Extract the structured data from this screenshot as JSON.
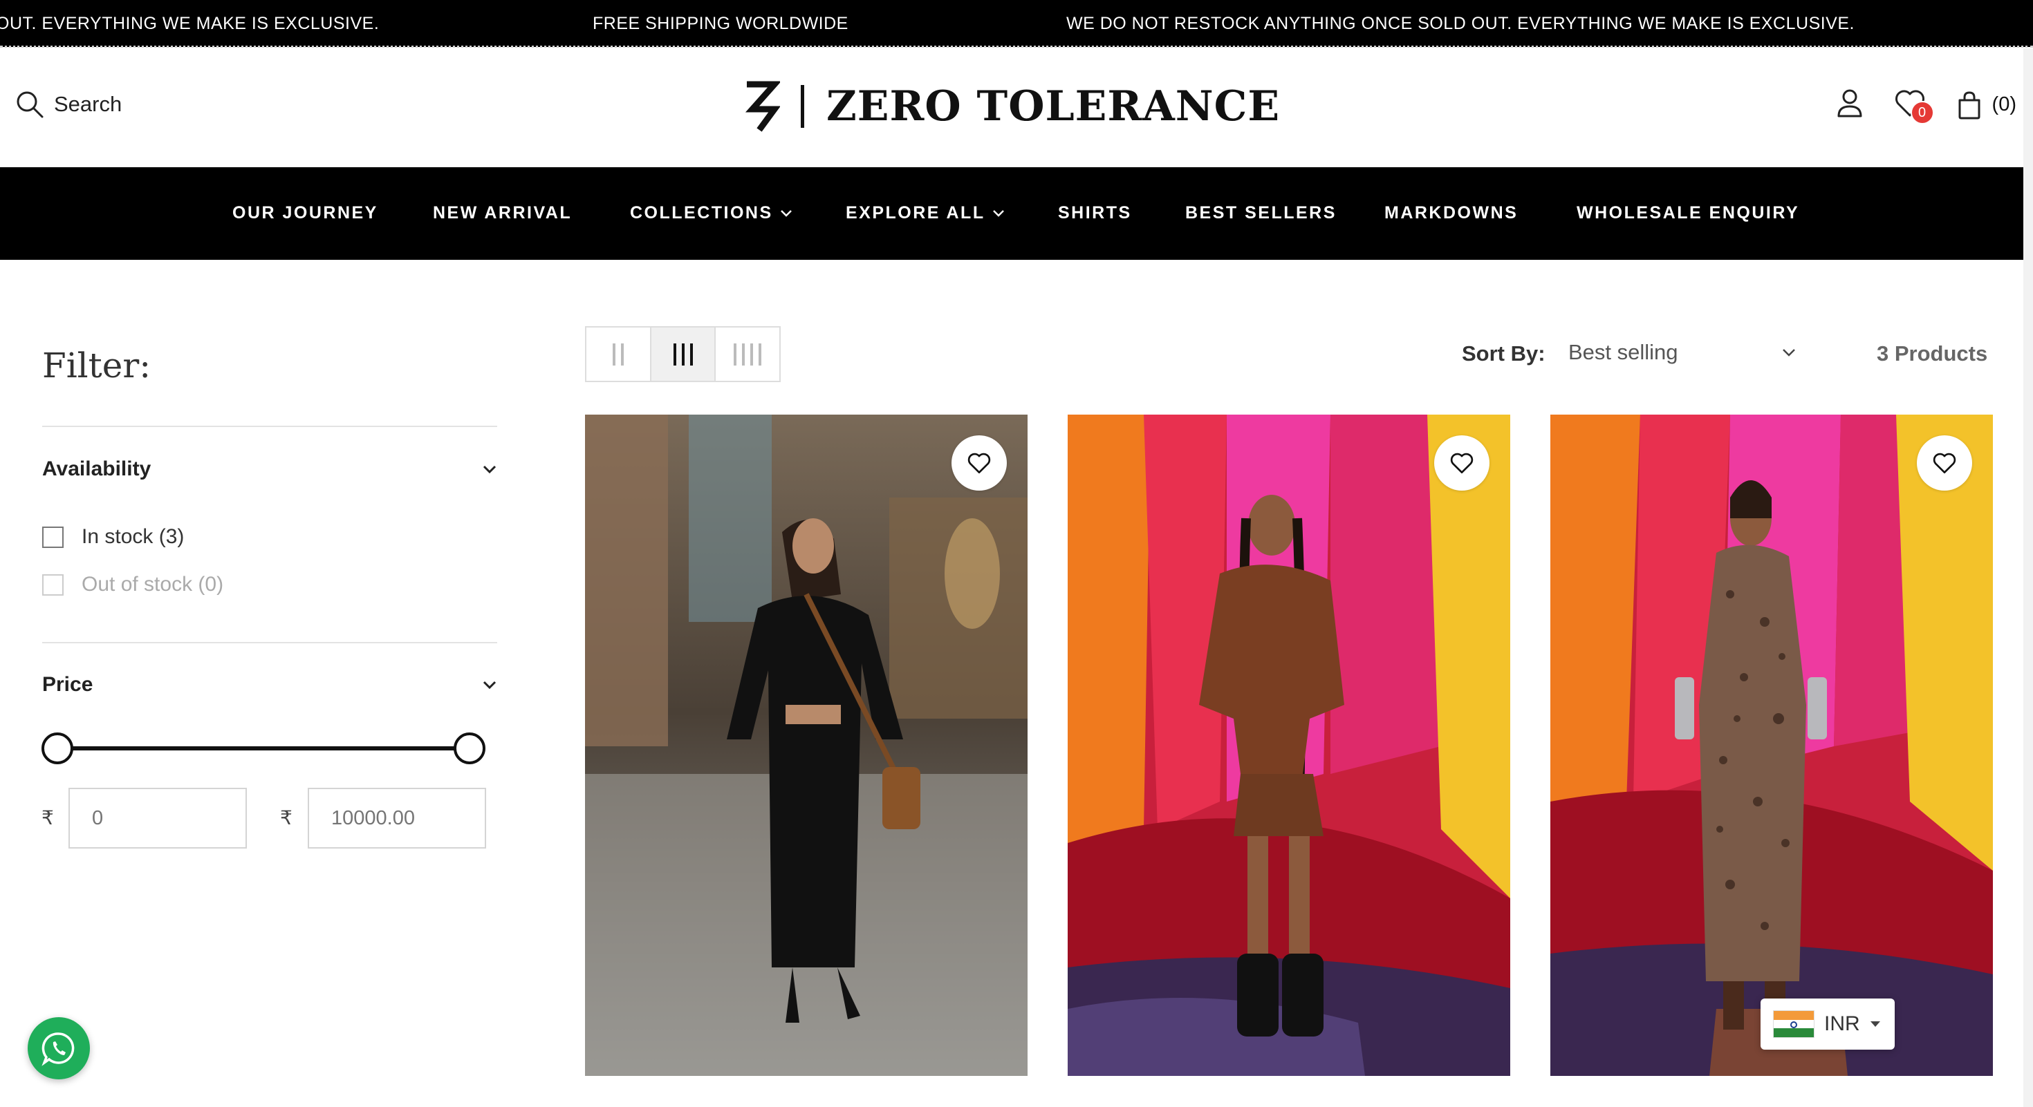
{
  "announcement": {
    "items": [
      "OUT. EVERYTHING WE MAKE IS EXCLUSIVE.",
      "FREE SHIPPING WORLDWIDE",
      "WE DO NOT RESTOCK ANYTHING ONCE SOLD OUT. EVERYTHING WE MAKE IS EXCLUSIVE."
    ]
  },
  "header": {
    "search_label": "Search",
    "brand": "ZERO TOLERANCE",
    "wishlist_count": "0",
    "cart_count": "(0)"
  },
  "nav": {
    "items": [
      {
        "label": "OUR JOURNEY"
      },
      {
        "label": "NEW ARRIVAL"
      },
      {
        "label": "COLLECTIONS"
      },
      {
        "label": "EXPLORE ALL"
      },
      {
        "label": "SHIRTS"
      },
      {
        "label": "BEST SELLERS"
      },
      {
        "label": "MARKDOWNS"
      },
      {
        "label": "WHOLESALE ENQUIRY"
      }
    ]
  },
  "filter": {
    "title": "Filter:",
    "availability": {
      "title": "Availability",
      "options": [
        {
          "label": "In stock (3)",
          "checked": false
        },
        {
          "label": "Out of stock (0)",
          "checked": false
        }
      ]
    },
    "price": {
      "title": "Price",
      "currency_symbol": "₹",
      "min_placeholder": "0",
      "max_placeholder": "10000.00",
      "range_min": 0,
      "range_max": 10000
    }
  },
  "toolbar": {
    "sort_label": "Sort By:",
    "sort_value": "Best selling",
    "product_count": "3 Products",
    "active_layout": "3 columns"
  },
  "products": [
    {
      "image": "model in black outfit walking in hall"
    },
    {
      "image": "model in brown shirt and skirt before colorful drapes"
    },
    {
      "image": "model in printed brown dress before colorful drapes"
    }
  ],
  "currency_widget": {
    "code": "INR"
  },
  "colors": {
    "brand_black": "#000000",
    "badge_red": "#e53935",
    "whatsapp_green": "#1fae5a"
  }
}
